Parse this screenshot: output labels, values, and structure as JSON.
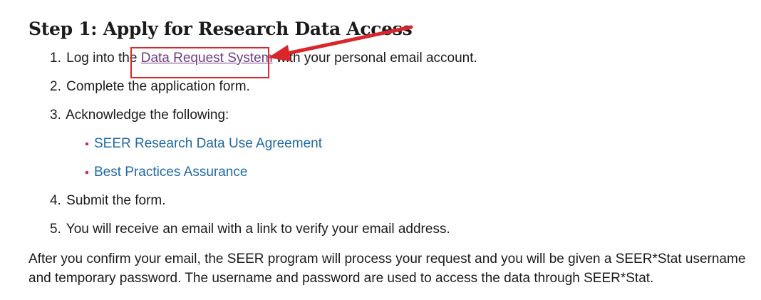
{
  "heading": "Step 1: Apply for Research Data Access",
  "steps": [
    {
      "num": "1.",
      "before": "Log into the",
      "link": "Data Request System",
      "after": "with your personal email account."
    },
    {
      "num": "2.",
      "text": "Complete the application form."
    },
    {
      "num": "3.",
      "text": "Acknowledge the following:"
    },
    {
      "num": "4.",
      "text": "Submit the form."
    },
    {
      "num": "5.",
      "text": "You will receive an email with a link to verify your email address."
    }
  ],
  "acknowledgements": [
    "SEER Research Data Use Agreement",
    "Best Practices Assurance"
  ],
  "paragraph": "After you confirm your email, the SEER program will process your request and you will be given a SEER*Stat username and temporary password. The username and password are used to access the data through SEER*Stat.",
  "colors": {
    "visited_link": "#6f3b86",
    "link": "#1f69a3",
    "bullet": "#d6246e",
    "annotation": "#d9262b"
  }
}
